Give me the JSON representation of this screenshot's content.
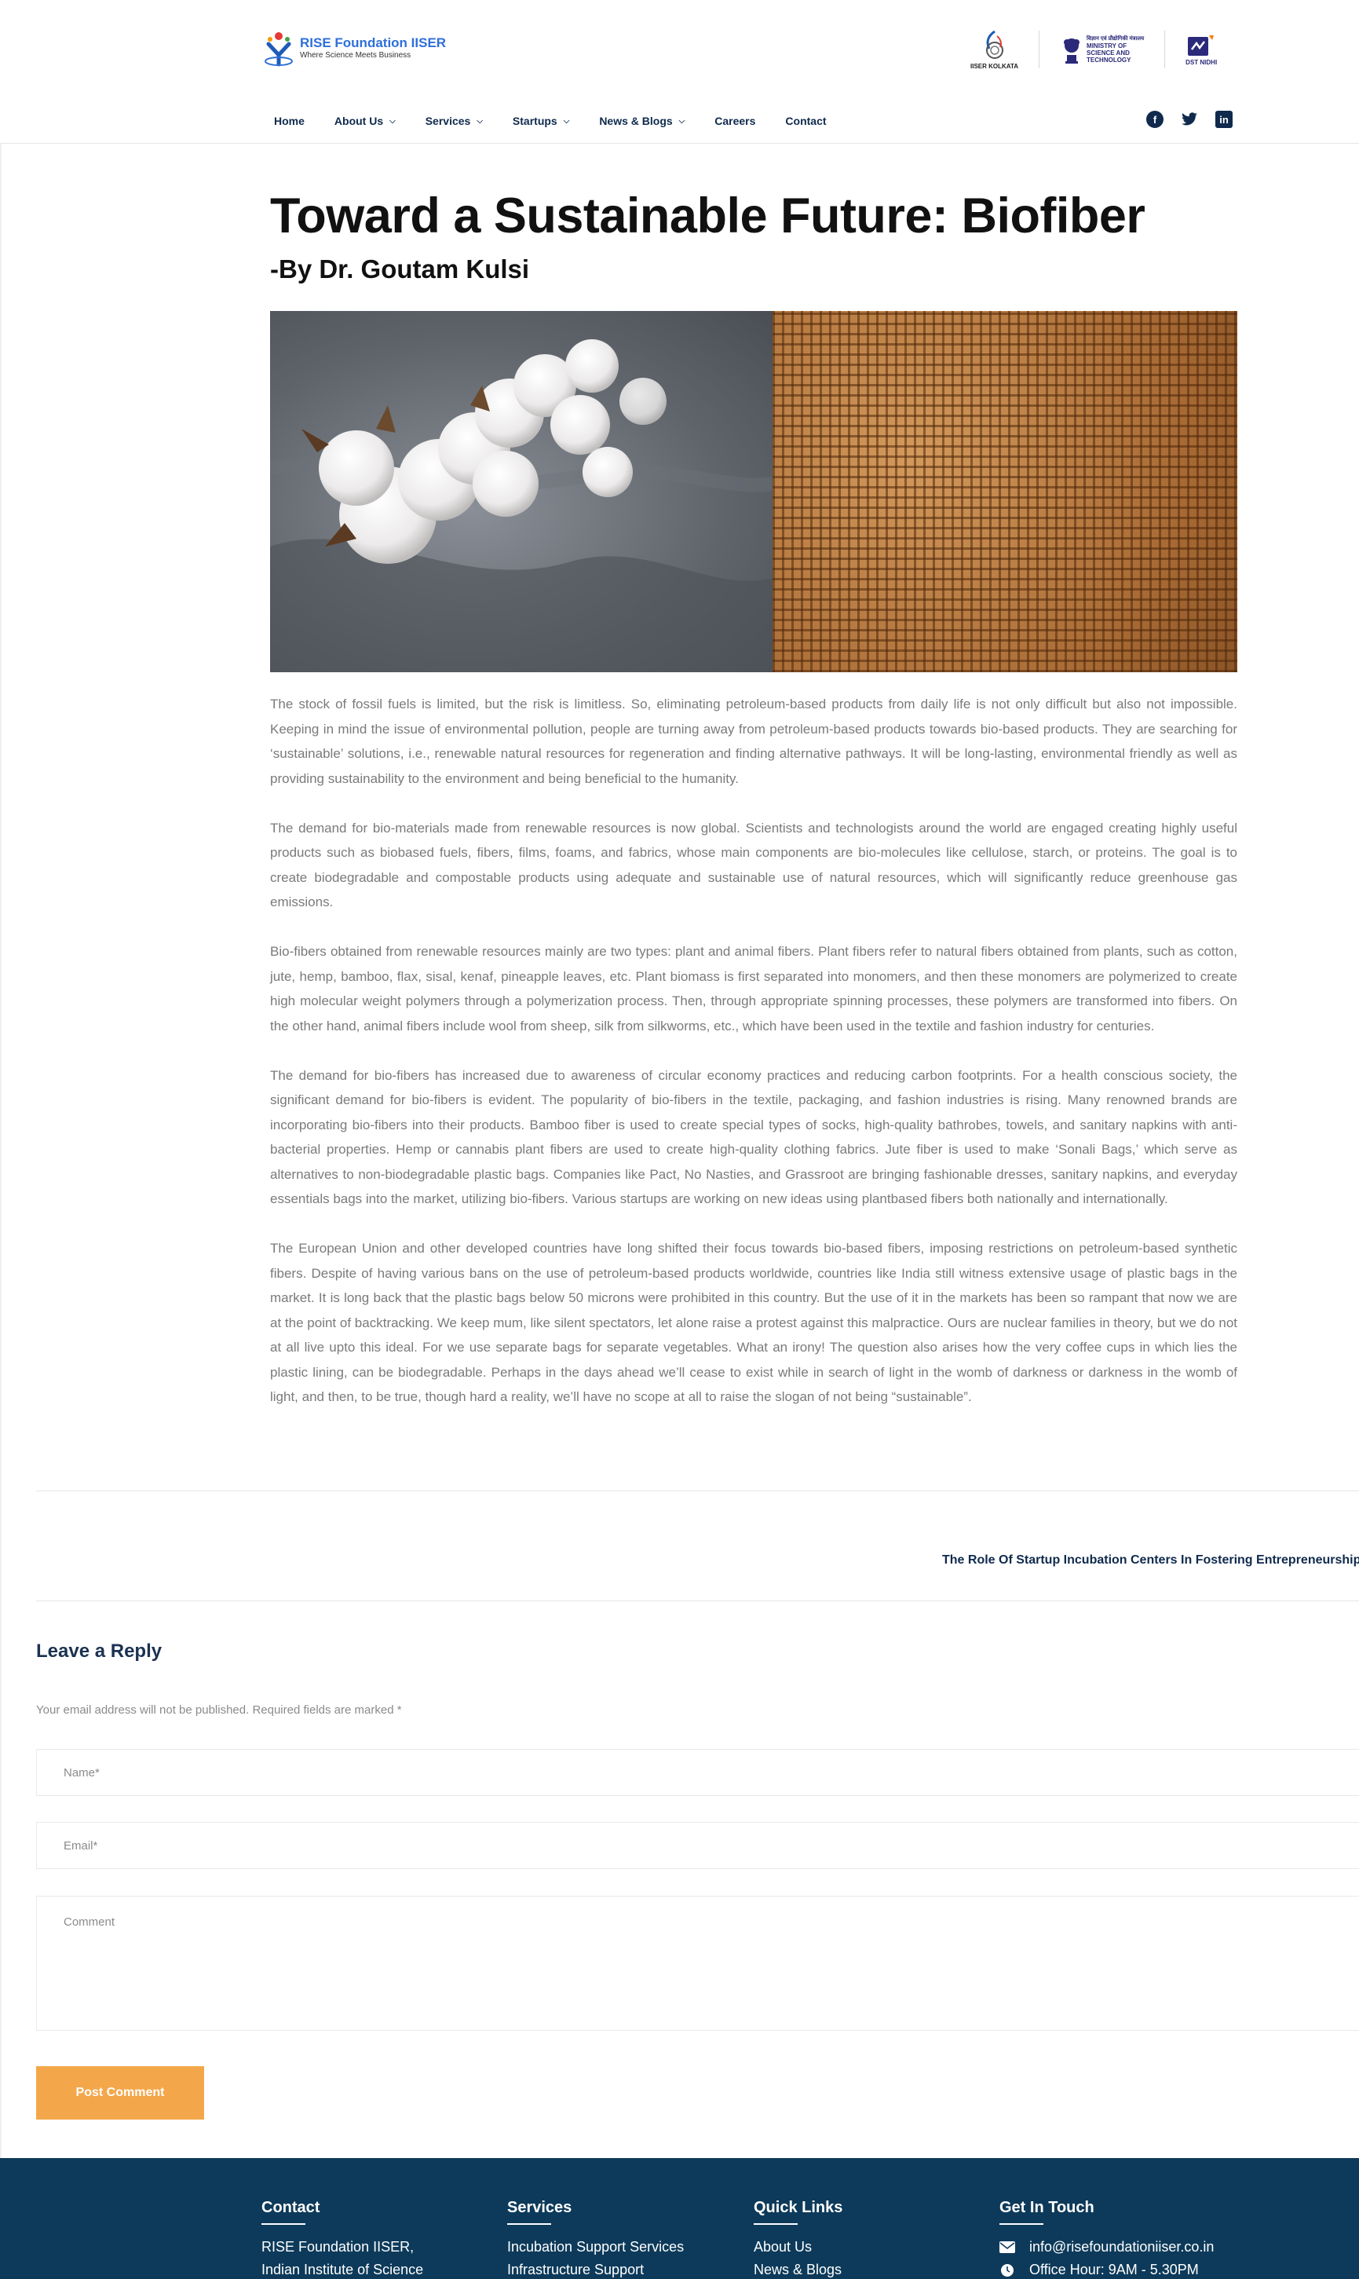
{
  "brand": {
    "title": "RISE Foundation IISER",
    "subtitle": "Where Science Meets Business"
  },
  "partners": {
    "iiser_label": "IISER KOLKATA",
    "mos_hindi": "विज्ञान एवं प्रौद्योगिकी मंत्रालय",
    "mos_line1": "MINISTRY OF",
    "mos_line2": "SCIENCE AND",
    "mos_line3": "TECHNOLOGY",
    "dst_label": "DST NIDHI"
  },
  "nav": {
    "items": [
      {
        "label": "Home",
        "has_dropdown": false
      },
      {
        "label": "About Us",
        "has_dropdown": true
      },
      {
        "label": "Services",
        "has_dropdown": true
      },
      {
        "label": "Startups",
        "has_dropdown": true
      },
      {
        "label": "News & Blogs",
        "has_dropdown": true
      },
      {
        "label": "Careers",
        "has_dropdown": false
      },
      {
        "label": "Contact",
        "has_dropdown": false
      }
    ],
    "social": [
      "facebook-icon",
      "twitter-icon",
      "linkedin-icon"
    ]
  },
  "article": {
    "title": "Toward a Sustainable Future: Biofiber",
    "byline": "-By Dr. Goutam Kulsi",
    "paragraphs": [
      "The stock of fossil fuels is limited, but the risk is limitless. So, eliminating petroleum-based products from daily life is not only difficult but also not impossible. Keeping in mind the issue of environmental pollution, people are turning away from petroleum-based products towards bio-based products. They are searching for ‘sustainable’ solutions, i.e., renewable natural resources for regeneration and finding alternative pathways. It will be long-lasting, environmental friendly as well as providing sustainability to the environment and being beneficial to the humanity.",
      "The demand for bio-materials made from renewable resources is now global. Scientists and technologists around the world are engaged creating highly useful products such as biobased fuels, fibers, films, foams, and fabrics, whose main components are bio-molecules like cellulose, starch, or proteins. The goal is to create biodegradable and compostable products using adequate and sustainable use of natural resources, which will significantly reduce greenhouse gas emissions.",
      "Bio-fibers obtained from renewable resources mainly are two types: plant and animal fibers. Plant fibers refer to natural fibers obtained from plants, such as cotton, jute, hemp, bamboo, flax, sisal, kenaf, pineapple leaves, etc. Plant biomass is first separated into monomers, and then these monomers are polymerized to create high molecular weight polymers through a polymerization process. Then, through appropriate spinning processes, these polymers are transformed into fibers. On the other hand, animal fibers include wool from sheep, silk from silkworms, etc., which have been used in the textile and fashion industry for centuries.",
      "The demand for bio-fibers has increased due to awareness of circular economy practices and reducing carbon footprints. For a health conscious society, the significant demand for bio-fibers is evident. The popularity of bio-fibers in the textile, packaging, and fashion industries is rising. Many renowned brands are incorporating bio-fibers into their products. Bamboo fiber is used to create special types of socks, high-quality bathrobes, towels, and sanitary napkins with anti-bacterial properties. Hemp or cannabis plant fibers are used to create high-quality clothing fabrics. Jute fiber is used to make ‘Sonali Bags,’ which serve as alternatives to non-biodegradable plastic bags. Companies like Pact, No Nasties, and Grassroot are bringing fashionable dresses, sanitary napkins, and everyday essentials bags into the market, utilizing bio-fibers. Various startups are working on new ideas using plantbased fibers both nationally and internationally.",
      "The European Union and other developed countries have long shifted their focus towards bio-based fibers, imposing restrictions on petroleum-based synthetic fibers. Despite of having various bans on the use of petroleum-based products worldwide, countries like India still witness extensive usage of plastic bags in the market. It is long back that the plastic bags below 50 microns were prohibited in this country. But the use of it in the markets has been so rampant that now we are at the point of backtracking. We keep mum, like silent spectators, let alone raise a protest against this malpractice. Ours are nuclear families in theory, but we do not at all live upto this ideal. For we use separate bags for separate vegetables. What an irony! The question also arises how the very coffee cups in which lies the plastic lining, can be biodegradable. Perhaps in the days ahead we’ll cease to exist while in search of light in the womb of darkness or darkness in the womb of light, and then, to be true, though hard a reality, we’ll have no scope at all to raise the slogan of not being “sustainable”."
    ]
  },
  "post_nav": {
    "next_title": "The Role Of Startup Incubation Centers In Fostering Entrepreneurship"
  },
  "reply": {
    "title": "Leave a Reply",
    "note": "Your email address will not be published. Required fields are marked *",
    "name_placeholder": "Name*",
    "email_placeholder": "Email*",
    "comment_placeholder": "Comment",
    "submit_label": "Post Comment"
  },
  "footer": {
    "contact": {
      "heading": "Contact",
      "lines": [
        "RISE Foundation IISER,",
        "Indian Institute of Science"
      ]
    },
    "services": {
      "heading": "Services",
      "lines": [
        "Incubation Support Services",
        "Infrastructure Support"
      ]
    },
    "quick_links": {
      "heading": "Quick Links",
      "lines": [
        "About Us",
        "News & Blogs"
      ]
    },
    "get_in_touch": {
      "heading": "Get In Touch",
      "email": "info@risefoundationiiser.co.in",
      "hours": "Office Hour: 9AM - 5.30PM"
    }
  },
  "colors": {
    "navy": "#0f2a4d",
    "footer_bg": "#0d3a5a",
    "accent_orange": "#f4a74a",
    "brand_blue": "#2f6fd8",
    "body_text": "#7a7a7a"
  }
}
